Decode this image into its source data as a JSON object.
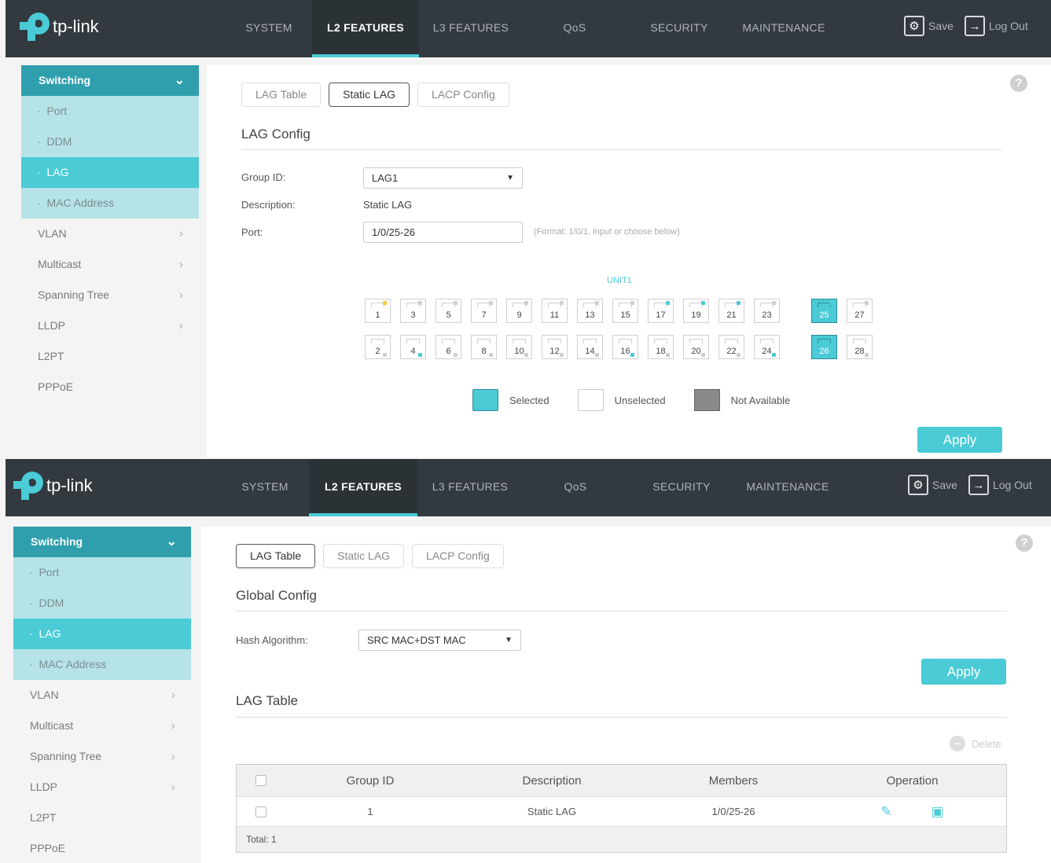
{
  "brand": "tp-link",
  "nav": [
    "SYSTEM",
    "L2 FEATURES",
    "L3 FEATURES",
    "QoS",
    "SECURITY",
    "MAINTENANCE"
  ],
  "nav_active": "L2 FEATURES",
  "actions": {
    "save": "Save",
    "logout": "Log Out"
  },
  "sidebar": {
    "header": "Switching",
    "subs": [
      "Port",
      "DDM",
      "LAG",
      "MAC Address"
    ],
    "active_sub": "LAG",
    "items": [
      "VLAN",
      "Multicast",
      "Spanning Tree",
      "LLDP",
      "L2PT",
      "PPPoE"
    ]
  },
  "tabs": [
    "LAG Table",
    "Static LAG",
    "LACP Config"
  ],
  "panel1": {
    "active_tab": "Static LAG",
    "section_title": "LAG Config",
    "group_id_label": "Group ID:",
    "group_id_value": "LAG1",
    "description_label": "Description:",
    "description_value": "Static LAG",
    "port_label": "Port:",
    "port_value": "1/0/25-26",
    "port_hint": "(Format: 1/0/1, input or choose below)",
    "unit_label": "UNIT1",
    "ports_top": [
      "1",
      "3",
      "5",
      "7",
      "9",
      "11",
      "13",
      "15",
      "17",
      "19",
      "21",
      "23",
      "25",
      "27"
    ],
    "ports_bottom": [
      "2",
      "4",
      "6",
      "8",
      "10",
      "12",
      "14",
      "16",
      "18",
      "20",
      "22",
      "24",
      "26",
      "28"
    ],
    "selected_ports": [
      "25",
      "26"
    ],
    "legend": {
      "selected": "Selected",
      "unselected": "Unselected",
      "not_available": "Not Available"
    },
    "apply": "Apply"
  },
  "panel2": {
    "active_tab": "LAG Table",
    "global_title": "Global Config",
    "hash_label": "Hash Algorithm:",
    "hash_value": "SRC MAC+DST MAC",
    "apply": "Apply",
    "table_title": "LAG Table",
    "delete": "Delete",
    "columns": [
      "Group ID",
      "Description",
      "Members",
      "Operation"
    ],
    "rows": [
      {
        "group_id": "1",
        "description": "Static LAG",
        "members": "1/0/25-26"
      }
    ],
    "total": "Total: 1"
  }
}
